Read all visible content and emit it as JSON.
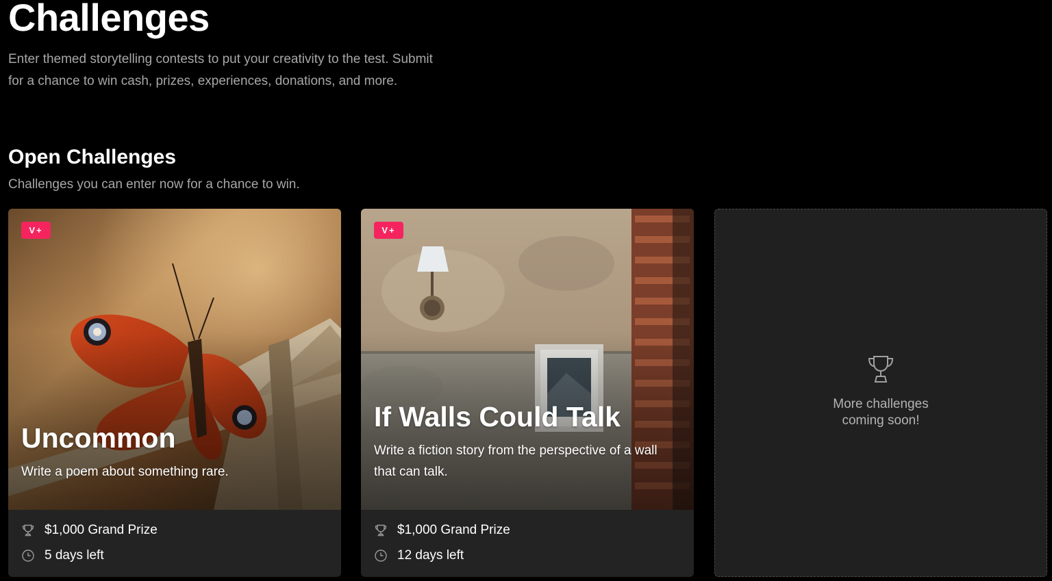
{
  "header": {
    "title": "Challenges",
    "description": "Enter themed storytelling contests to put your creativity to the test. Submit for a chance to win cash, prizes, experiences, donations, and more."
  },
  "section": {
    "title": "Open Challenges",
    "subtitle": "Challenges you can enter now for a chance to win."
  },
  "cards": [
    {
      "badge": "V+",
      "title": "Uncommon",
      "description": "Write a poem about something rare.",
      "prize": "$1,000 Grand Prize",
      "time_left": "5 days left",
      "image": "peacock-butterfly-photo"
    },
    {
      "badge": "V+",
      "title": "If Walls Could Talk",
      "description": "Write a fiction story from the perspective of a wall that can talk.",
      "prize": "$1,000 Grand Prize",
      "time_left": "12 days left",
      "image": "old-wall-lamp-photo"
    }
  ],
  "placeholder": {
    "text_line1": "More challenges",
    "text_line2": "coming soon!",
    "icon": "trophy-icon"
  },
  "colors": {
    "background": "#000000",
    "card_footer": "#232323",
    "badge": "#f5245e",
    "muted_text": "#a7a7a7"
  }
}
